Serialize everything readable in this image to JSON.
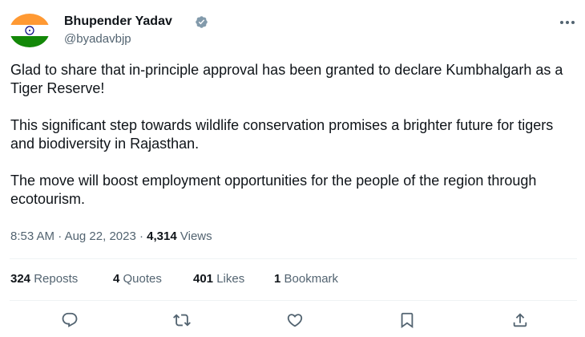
{
  "author": {
    "name": "Bhupender Yadav",
    "handle": "@byadavbjp",
    "verified_color": "#829aab",
    "avatar_flag_colors": [
      "#ff9933",
      "#ffffff",
      "#138808"
    ],
    "avatar_chakra_color": "#000080"
  },
  "tweet": {
    "paragraphs": [
      "Glad to share that in-principle approval has been granted to declare Kumbhalgarh as a Tiger Reserve!",
      "This significant step towards wildlife conservation promises a brighter future for tigers and biodiversity in Rajasthan.",
      "The move will boost employment opportunities for the people of the region through ecotourism."
    ]
  },
  "meta": {
    "time": "8:53 AM",
    "separator": "·",
    "date": "Aug 22, 2023",
    "views_count": "4,314",
    "views_label": "Views"
  },
  "stats": {
    "reposts_count": "324",
    "reposts_label": "Reposts",
    "quotes_count": "4",
    "quotes_label": "Quotes",
    "likes_count": "401",
    "likes_label": "Likes",
    "bookmarks_count": "1",
    "bookmarks_label": "Bookmark"
  },
  "actions": [
    {
      "icon": "reply-icon"
    },
    {
      "icon": "repost-icon"
    },
    {
      "icon": "like-icon"
    },
    {
      "icon": "bookmark-icon"
    },
    {
      "icon": "share-icon"
    }
  ],
  "colors": {
    "text_primary": "#0f1419",
    "text_secondary": "#536471",
    "divider": "#eff3f4"
  }
}
